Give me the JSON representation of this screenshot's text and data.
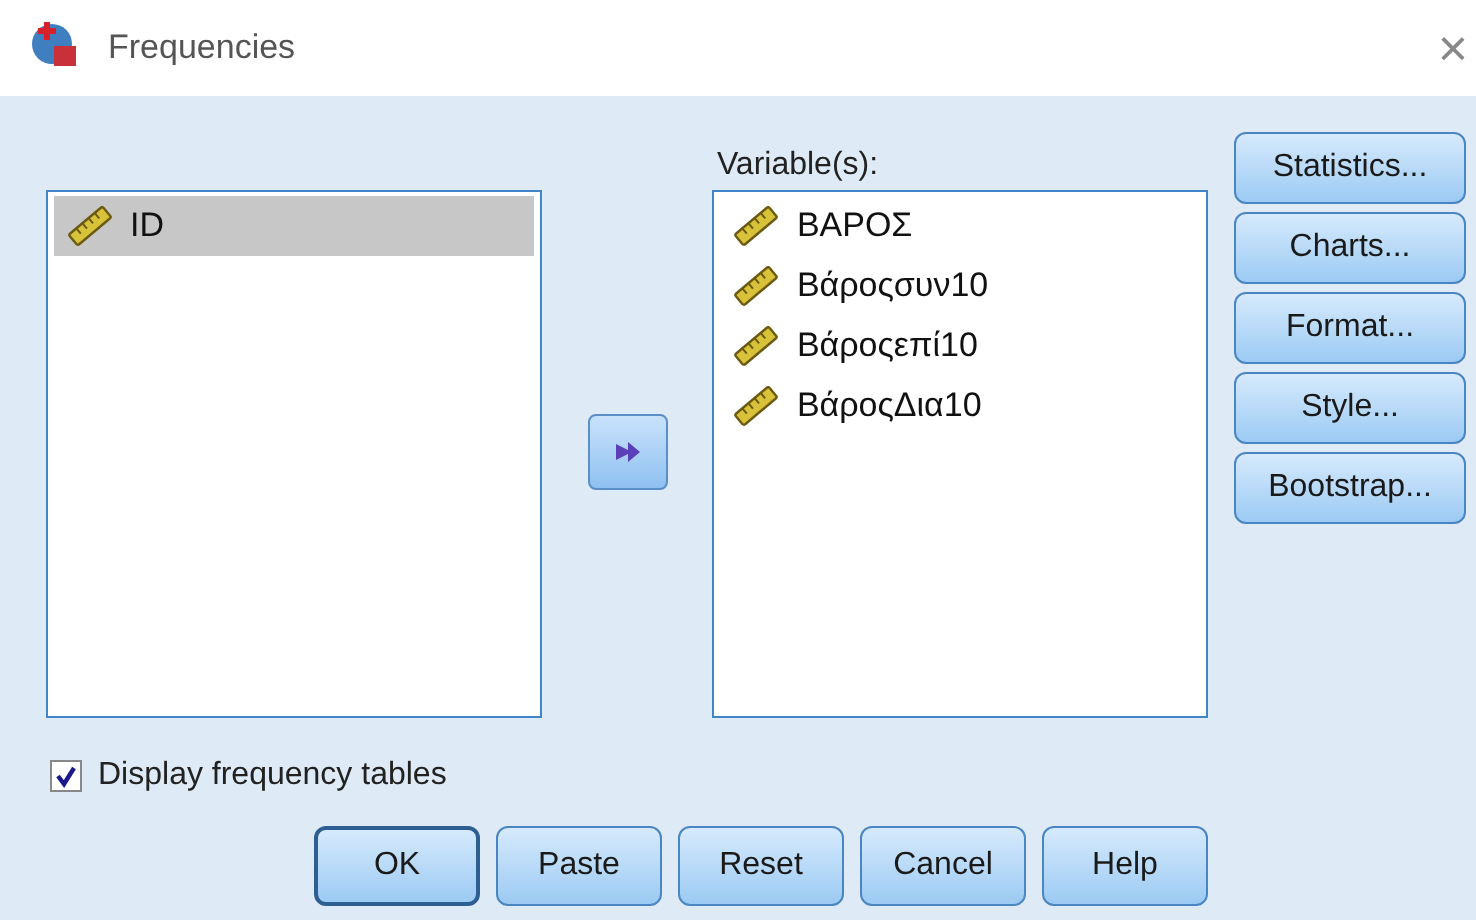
{
  "window": {
    "title": "Frequencies",
    "close": "×"
  },
  "source_list": {
    "items": [
      {
        "label": "ID",
        "selected": true
      }
    ]
  },
  "variables": {
    "label": "Variable(s):",
    "items": [
      {
        "label": "ΒΑΡΟΣ",
        "selected": false
      },
      {
        "label": "Βάροςσυν10",
        "selected": false
      },
      {
        "label": "Βάροςεπί10",
        "selected": false
      },
      {
        "label": "ΒάροςΔια10",
        "selected": false
      }
    ]
  },
  "side_buttons": [
    {
      "label": "Statistics..."
    },
    {
      "label": "Charts..."
    },
    {
      "label": "Format..."
    },
    {
      "label": "Style..."
    },
    {
      "label": "Bootstrap..."
    }
  ],
  "display_frequency_tables": {
    "label": "Display frequency tables",
    "checked": true
  },
  "buttons": [
    {
      "label": "OK",
      "default": true
    },
    {
      "label": "Paste",
      "default": false
    },
    {
      "label": "Reset",
      "default": false
    },
    {
      "label": "Cancel",
      "default": false
    },
    {
      "label": "Help",
      "default": false
    }
  ]
}
